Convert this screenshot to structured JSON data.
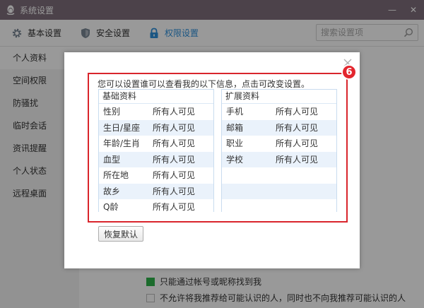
{
  "window": {
    "title": "系统设置",
    "minimize": "—",
    "close": "✕"
  },
  "tabs": [
    {
      "label": "基本设置",
      "icon": "gear-icon"
    },
    {
      "label": "安全设置",
      "icon": "shield-icon"
    },
    {
      "label": "权限设置",
      "icon": "lock-icon",
      "active": true
    }
  ],
  "search": {
    "placeholder": "搜索设置项"
  },
  "sidebar": {
    "items": [
      {
        "label": "个人资料",
        "active": true
      },
      {
        "label": "空间权限"
      },
      {
        "label": "防骚扰"
      },
      {
        "label": "临时会话"
      },
      {
        "label": "资讯提醒"
      },
      {
        "label": "个人状态"
      },
      {
        "label": "远程桌面"
      }
    ]
  },
  "background_options": [
    {
      "label": "只能通过帐号或昵称找到我",
      "checked": true
    },
    {
      "label": "不允许将我推荐给可能认识的人，同时也不向我推荐可能认识的人",
      "checked": false
    }
  ],
  "dialog": {
    "badge": "6",
    "intro": "您可以设置谁可以查看我的以下信息，点击可改变设置。",
    "left_panel": {
      "title": "基础资料",
      "rows": [
        {
          "key": "性别",
          "value": "所有人可见"
        },
        {
          "key": "生日/星座",
          "value": "所有人可见"
        },
        {
          "key": "年龄/生肖",
          "value": "所有人可见"
        },
        {
          "key": "血型",
          "value": "所有人可见"
        },
        {
          "key": "所在地",
          "value": "所有人可见"
        },
        {
          "key": "故乡",
          "value": "所有人可见"
        },
        {
          "key": "Q龄",
          "value": "所有人可见"
        }
      ]
    },
    "right_panel": {
      "title": "扩展资料",
      "rows": [
        {
          "key": "手机",
          "value": "所有人可见"
        },
        {
          "key": "邮箱",
          "value": "所有人可见"
        },
        {
          "key": "职业",
          "value": "所有人可见"
        },
        {
          "key": "学校",
          "value": "所有人可见"
        },
        {
          "key": "",
          "value": ""
        },
        {
          "key": "",
          "value": ""
        },
        {
          "key": "",
          "value": ""
        }
      ]
    },
    "restore_label": "恢复默认"
  },
  "colors": {
    "titlebar": "#7f6f7c",
    "accent": "#2d8fdb",
    "highlight_border": "#d9252c",
    "check_green": "#2db34a"
  }
}
